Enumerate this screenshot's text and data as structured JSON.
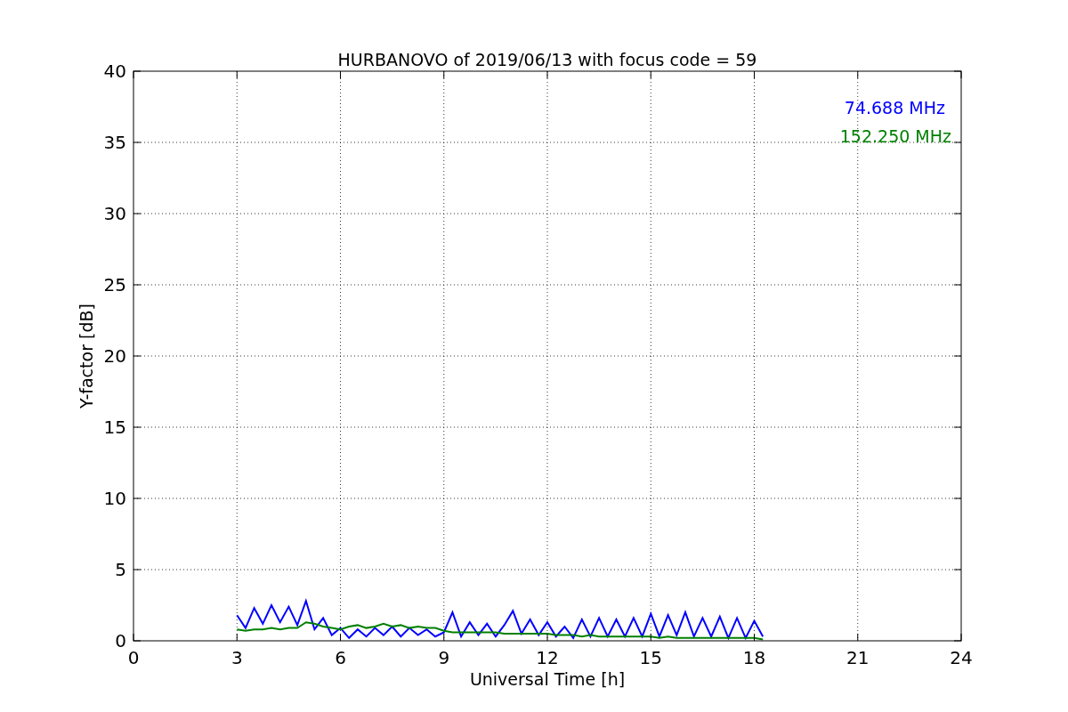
{
  "chart_data": {
    "type": "line",
    "title": "HURBANOVO of 2019/06/13 with focus code = 59",
    "xlabel": "Universal Time [h]",
    "ylabel": "Y-factor [dB]",
    "x": [
      3,
      3.25,
      3.5,
      3.75,
      4,
      4.25,
      4.5,
      4.75,
      5,
      5.25,
      5.5,
      5.75,
      6,
      6.25,
      6.5,
      6.75,
      7,
      7.25,
      7.5,
      7.75,
      8,
      8.25,
      8.5,
      8.75,
      9,
      9.25,
      9.5,
      9.75,
      10,
      10.25,
      10.5,
      10.75,
      11,
      11.25,
      11.5,
      11.75,
      12,
      12.25,
      12.5,
      12.75,
      13,
      13.25,
      13.5,
      13.75,
      14,
      14.25,
      14.5,
      14.75,
      15,
      15.25,
      15.5,
      15.75,
      16,
      16.25,
      16.5,
      16.75,
      17,
      17.25,
      17.5,
      17.75,
      18,
      18.25
    ],
    "series": [
      {
        "name": "74.688 MHz",
        "color": "#0000ff",
        "values": [
          1.8,
          0.9,
          2.3,
          1.2,
          2.5,
          1.3,
          2.4,
          1.1,
          2.8,
          0.8,
          1.6,
          0.4,
          0.9,
          0.2,
          0.8,
          0.3,
          0.9,
          0.4,
          1.0,
          0.3,
          0.9,
          0.4,
          0.8,
          0.3,
          0.6,
          2.0,
          0.3,
          1.3,
          0.4,
          1.2,
          0.3,
          1.1,
          2.1,
          0.5,
          1.5,
          0.4,
          1.3,
          0.3,
          1.0,
          0.2,
          1.5,
          0.3,
          1.6,
          0.3,
          1.5,
          0.3,
          1.6,
          0.3,
          1.9,
          0.3,
          1.8,
          0.4,
          2.0,
          0.3,
          1.6,
          0.3,
          1.7,
          0.2,
          1.6,
          0.2,
          1.4,
          0.3
        ]
      },
      {
        "name": "152.250 MHz",
        "color": "#008000",
        "values": [
          0.8,
          0.7,
          0.8,
          0.8,
          0.9,
          0.8,
          0.9,
          0.9,
          1.3,
          1.2,
          1.0,
          0.9,
          0.8,
          1.0,
          1.1,
          0.9,
          1.0,
          1.2,
          1.0,
          1.1,
          0.9,
          1.0,
          0.9,
          0.9,
          0.7,
          0.6,
          0.6,
          0.6,
          0.6,
          0.6,
          0.6,
          0.5,
          0.5,
          0.5,
          0.5,
          0.5,
          0.5,
          0.4,
          0.4,
          0.4,
          0.3,
          0.4,
          0.3,
          0.3,
          0.3,
          0.3,
          0.3,
          0.3,
          0.3,
          0.2,
          0.3,
          0.2,
          0.2,
          0.2,
          0.2,
          0.2,
          0.2,
          0.2,
          0.2,
          0.2,
          0.2,
          0.1
        ]
      }
    ],
    "grid": true,
    "xlim": [
      0,
      24
    ],
    "ylim": [
      0,
      40
    ],
    "xticks": [
      0,
      3,
      6,
      9,
      12,
      15,
      18,
      21,
      24
    ],
    "yticks": [
      0,
      5,
      10,
      15,
      20,
      25,
      30,
      35,
      40
    ]
  }
}
